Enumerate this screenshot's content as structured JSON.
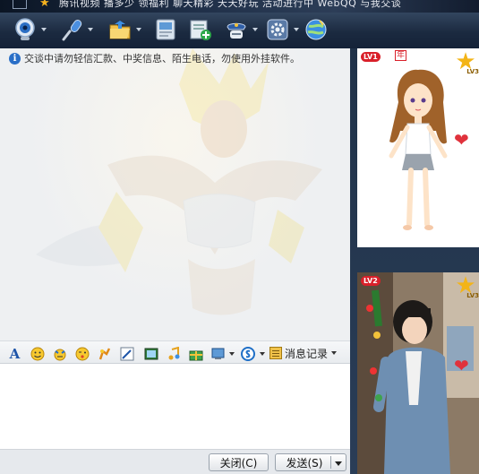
{
  "titlebar": {
    "text": "腾讯视频 播多少 领福利 聊天精彩 天天好玩 活动进行中 WebQQ 与我交谈"
  },
  "toolbar": {
    "buttons": [
      {
        "name": "video-chat",
        "icon": "camera-icon",
        "has_menu": true
      },
      {
        "name": "voice-chat",
        "icon": "microphone-icon",
        "has_menu": true
      },
      {
        "name": "send-file",
        "icon": "folder-icon",
        "has_menu": true
      },
      {
        "name": "send-sms",
        "icon": "message-icon",
        "has_menu": false
      },
      {
        "name": "create-group",
        "icon": "add-group-icon",
        "has_menu": false
      },
      {
        "name": "remote-assist",
        "icon": "police-icon",
        "has_menu": true
      },
      {
        "name": "apps",
        "icon": "gear-icon",
        "has_menu": true
      },
      {
        "name": "browser",
        "icon": "globe-icon",
        "has_menu": false
      }
    ]
  },
  "chat": {
    "notice": "交谈中请勿轻信汇款、中奖信息、陌生电话，勿使用外挂软件。"
  },
  "format_bar": {
    "items": [
      "font-icon",
      "smiley-icon",
      "magic-emoticon-icon",
      "wink-icon",
      "shake-icon",
      "draw-icon",
      "screenshot-icon",
      "music-icon",
      "gift-icon",
      "image-icon",
      "payment-icon"
    ],
    "history_label": "消息记录"
  },
  "buttons": {
    "close": "关闭(C)",
    "send": "发送(S)"
  },
  "side": {
    "card1": {
      "level": "LV1",
      "year": "年",
      "star_level": "LV3"
    },
    "card2": {
      "level": "LV2",
      "star_level": "LV3"
    }
  },
  "colors": {
    "toolbar_bg": "#1b2a40",
    "accent_blue": "#2a6fc7",
    "badge_red": "#d9202a",
    "star_gold": "#f3b417"
  }
}
